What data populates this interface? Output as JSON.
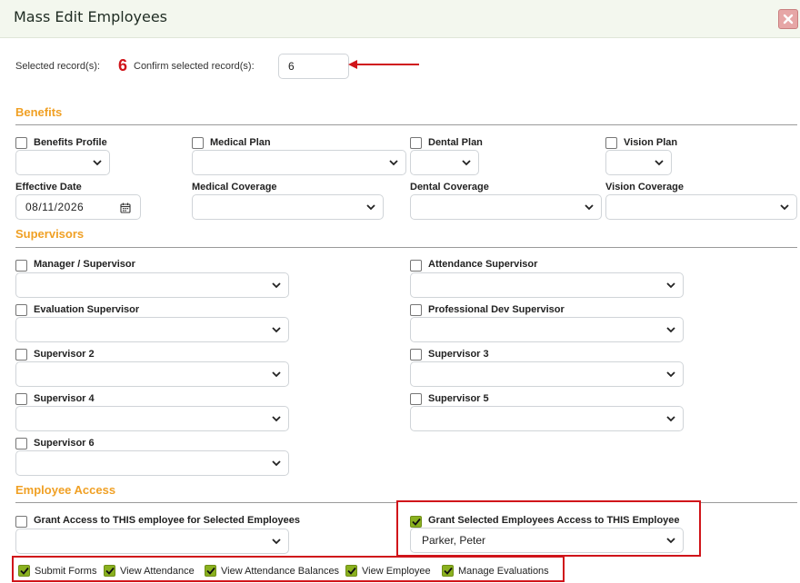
{
  "dialog": {
    "title": "Mass Edit Employees",
    "close_icon": "close-x-icon"
  },
  "records": {
    "selected_label": "Selected record(s):",
    "selected_count": "6",
    "confirm_label": "Confirm selected record(s):",
    "confirm_value": "6"
  },
  "benefits": {
    "title": "Benefits",
    "benefits_profile": "Benefits Profile",
    "medical_plan": "Medical Plan",
    "dental_plan": "Dental Plan",
    "vision_plan": "Vision Plan",
    "effective_date_label": "Effective Date",
    "effective_date_value": "08/11/2026",
    "medical_coverage": "Medical Coverage",
    "dental_coverage": "Dental Coverage",
    "vision_coverage": "Vision Coverage"
  },
  "supervisors": {
    "title": "Supervisors",
    "manager": "Manager / Supervisor",
    "attendance": "Attendance Supervisor",
    "evaluation": "Evaluation Supervisor",
    "professional_dev": "Professional Dev Supervisor",
    "supervisor2": "Supervisor 2",
    "supervisor3": "Supervisor 3",
    "supervisor4": "Supervisor 4",
    "supervisor5": "Supervisor 5",
    "supervisor6": "Supervisor 6"
  },
  "access": {
    "title": "Employee Access",
    "grant_this_for_selected": "Grant Access to THIS employee for Selected Employees",
    "grant_selected_to_this": "Grant Selected Employees Access to THIS Employee",
    "grant_selected_to_this_value": "Parker, Peter",
    "permissions": {
      "submit_forms": "Submit Forms",
      "view_attendance": "View Attendance",
      "view_attendance_balances": "View Attendance Balances",
      "view_employee": "View Employee",
      "manage_evaluations": "Manage Evaluations"
    }
  },
  "colors": {
    "accent": "#f0a024",
    "highlight": "#d0141a",
    "checkbox_checked": "#8ab11f"
  }
}
